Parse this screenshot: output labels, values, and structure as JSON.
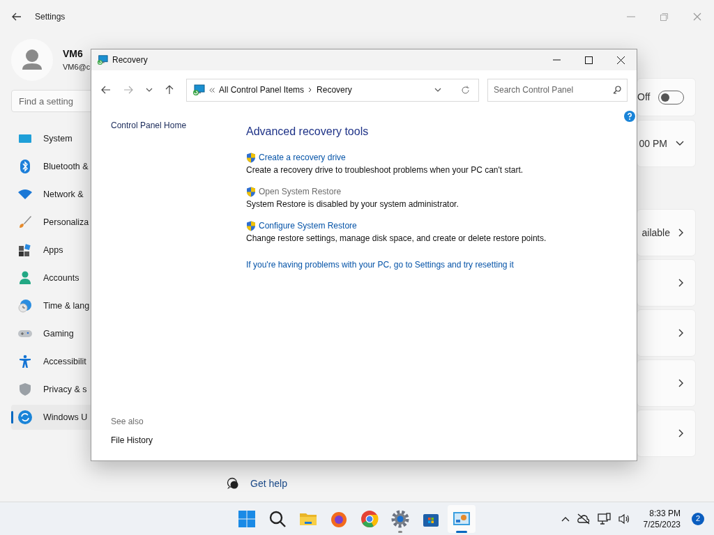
{
  "settings": {
    "title": "Settings",
    "user": {
      "name": "VM6",
      "email": "VM6@c"
    },
    "search": {
      "placeholder": "Find a setting"
    },
    "nav": [
      {
        "label": "System",
        "selected": false
      },
      {
        "label": "Bluetooth &",
        "selected": false
      },
      {
        "label": "Network &",
        "selected": false
      },
      {
        "label": "Personaliza",
        "selected": false
      },
      {
        "label": "Apps",
        "selected": false
      },
      {
        "label": "Accounts",
        "selected": false
      },
      {
        "label": "Time & lang",
        "selected": false
      },
      {
        "label": "Gaming",
        "selected": false
      },
      {
        "label": "Accessibilit",
        "selected": false
      },
      {
        "label": "Privacy & s",
        "selected": false
      },
      {
        "label": "Windows U",
        "selected": true
      }
    ],
    "cards": [
      {
        "kind": "toggle",
        "text": "Off",
        "on": false
      },
      {
        "kind": "dropdown",
        "text": "00 PM"
      },
      {
        "kind": "link",
        "text": "ailable"
      },
      {
        "kind": "link"
      },
      {
        "kind": "link"
      },
      {
        "kind": "link"
      },
      {
        "kind": "link"
      }
    ],
    "get_help": "Get help"
  },
  "dialog": {
    "title": "Recovery",
    "breadcrumb": [
      "All Control Panel Items",
      "Recovery"
    ],
    "search": {
      "placeholder": "Search Control Panel"
    },
    "sidebar_link": "Control Panel Home",
    "heading": "Advanced recovery tools",
    "tools": [
      {
        "link": "Create a recovery drive",
        "description": "Create a recovery drive to troubleshoot problems when your PC can't start.",
        "disabled": false
      },
      {
        "link": "Open System Restore",
        "description": "System Restore is disabled by your system administrator.",
        "disabled": true
      },
      {
        "link": "Configure System Restore",
        "description": "Change restore settings, manage disk space, and create or delete restore points.",
        "disabled": false
      }
    ],
    "reset_link": "If you're having problems with your PC, go to Settings and try resetting it",
    "see_also": {
      "title": "See also",
      "items": [
        "File History"
      ]
    }
  },
  "taskbar": {
    "apps": [
      {
        "running": false,
        "active": false
      },
      {
        "running": false,
        "active": false
      },
      {
        "running": false,
        "active": false
      },
      {
        "running": false,
        "active": false
      },
      {
        "running": false,
        "active": false
      },
      {
        "running": true,
        "active": false
      },
      {
        "running": false,
        "active": false
      },
      {
        "running": true,
        "active": true
      }
    ],
    "time": "8:33 PM",
    "date": "7/25/2023",
    "notifications": "2"
  }
}
